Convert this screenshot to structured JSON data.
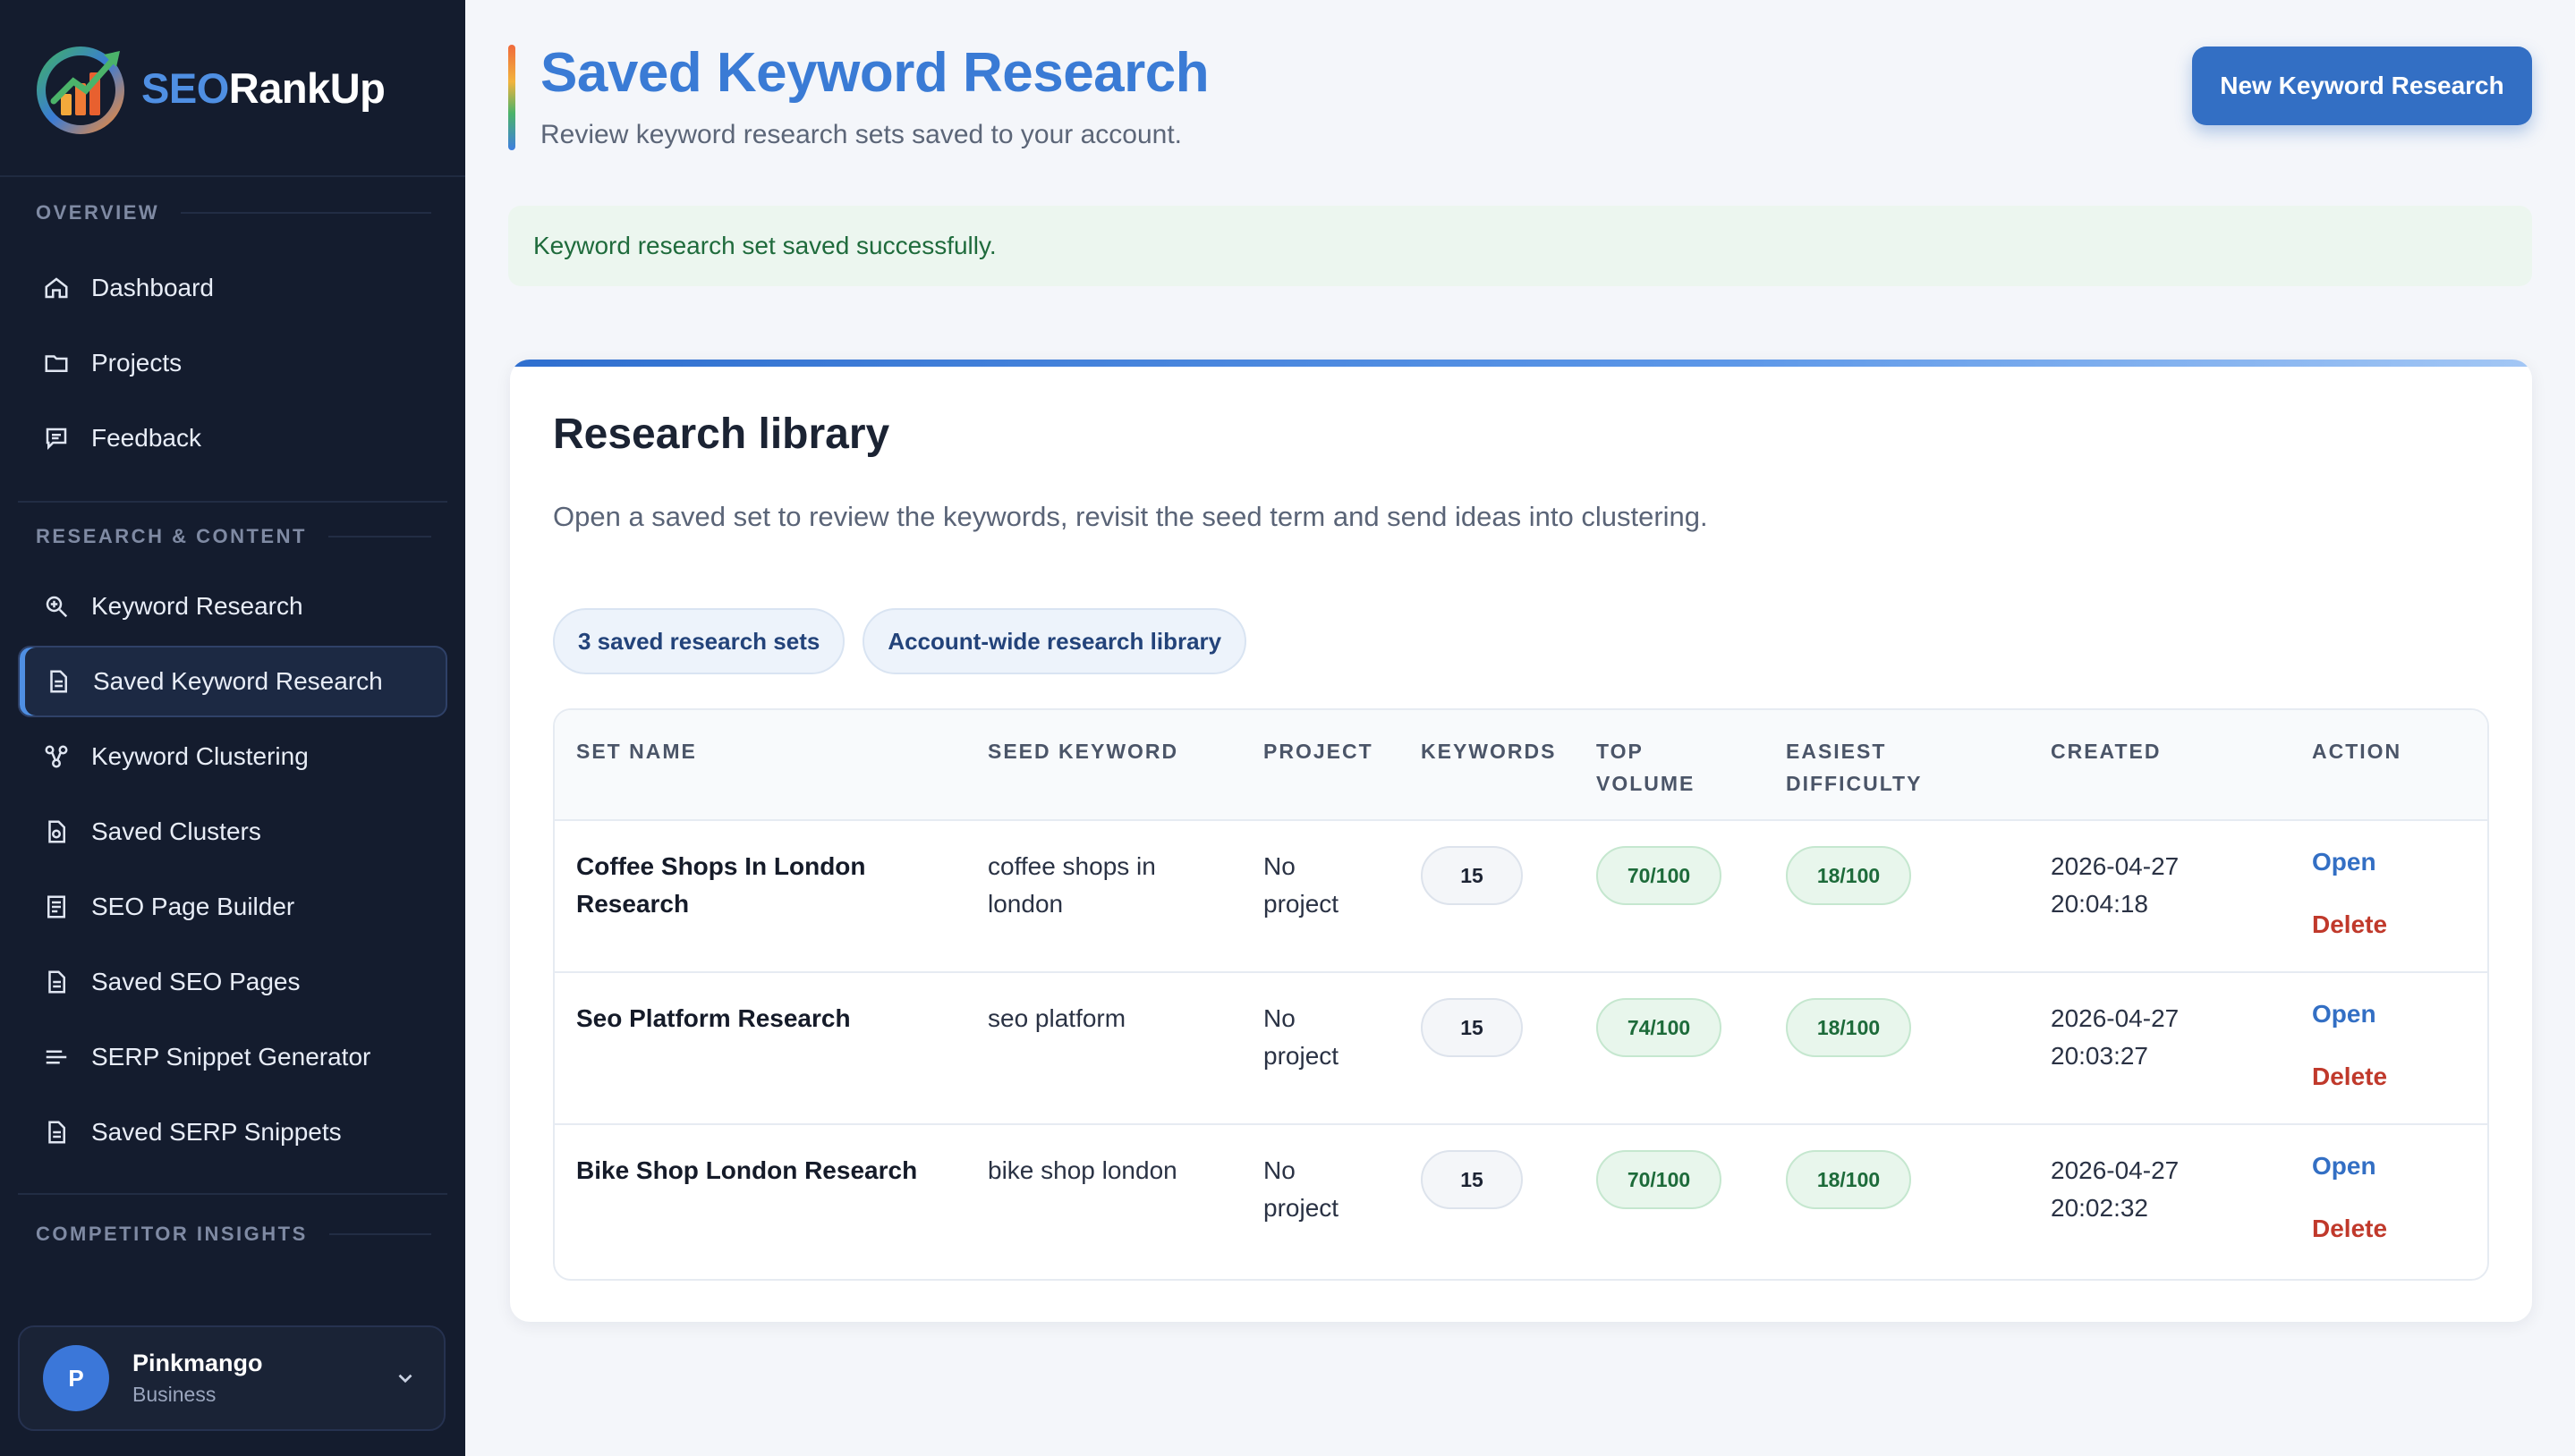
{
  "brand": {
    "name_part1": "SEO",
    "name_part2": "RankUp"
  },
  "sidebar": {
    "sections": [
      {
        "label": "OVERVIEW"
      },
      {
        "label": "RESEARCH & CONTENT"
      },
      {
        "label": "COMPETITOR INSIGHTS"
      }
    ],
    "items": [
      {
        "label": "Dashboard",
        "icon": "home-icon"
      },
      {
        "label": "Projects",
        "icon": "folder-icon"
      },
      {
        "label": "Feedback",
        "icon": "chat-icon"
      },
      {
        "label": "Keyword Research",
        "icon": "search-icon"
      },
      {
        "label": "Saved Keyword Research",
        "icon": "document-icon",
        "active": true
      },
      {
        "label": "Keyword Clustering",
        "icon": "cluster-icon"
      },
      {
        "label": "Saved Clusters",
        "icon": "saved-document-icon"
      },
      {
        "label": "SEO Page Builder",
        "icon": "page-icon"
      },
      {
        "label": "Saved SEO Pages",
        "icon": "document-icon"
      },
      {
        "label": "SERP Snippet Generator",
        "icon": "lines-icon"
      },
      {
        "label": "Saved SERP Snippets",
        "icon": "document-icon"
      }
    ],
    "user": {
      "initial": "P",
      "name": "Pinkmango",
      "plan": "Business"
    }
  },
  "header": {
    "title": "Saved Keyword Research",
    "subtitle": "Review keyword research sets saved to your account.",
    "new_button": "New Keyword Research"
  },
  "alert": {
    "text": "Keyword research set saved successfully."
  },
  "library": {
    "title": "Research library",
    "description": "Open a saved set to review the keywords, revisit the seed term and send ideas into clustering.",
    "pills": [
      "3 saved research sets",
      "Account-wide research library"
    ],
    "columns": {
      "set_name": "SET NAME",
      "seed_keyword": "SEED KEYWORD",
      "project": "PROJECT",
      "keywords": "KEYWORDS",
      "top_volume_1": "TOP",
      "top_volume_2": "VOLUME",
      "easiest_difficulty_1": "EASIEST",
      "easiest_difficulty_2": "DIFFICULTY",
      "created": "CREATED",
      "action": "ACTION"
    },
    "rows": [
      {
        "name_1": "Coffee Shops In London",
        "name_2": "Research",
        "seed_1": "coffee shops in",
        "seed_2": "london",
        "project_1": "No",
        "project_2": "project",
        "keywords": "15",
        "top_volume": "70/100",
        "difficulty": "18/100",
        "date": "2026-04-27",
        "time": "20:04:18",
        "open": "Open",
        "delete": "Delete"
      },
      {
        "name_1": "Seo Platform Research",
        "name_2": "",
        "seed_1": "seo platform",
        "seed_2": "",
        "project_1": "No",
        "project_2": "project",
        "keywords": "15",
        "top_volume": "74/100",
        "difficulty": "18/100",
        "date": "2026-04-27",
        "time": "20:03:27",
        "open": "Open",
        "delete": "Delete"
      },
      {
        "name_1": "Bike Shop London Research",
        "name_2": "",
        "seed_1": "bike shop london",
        "seed_2": "",
        "project_1": "No",
        "project_2": "project",
        "keywords": "15",
        "top_volume": "70/100",
        "difficulty": "18/100",
        "date": "2026-04-27",
        "time": "20:02:32",
        "open": "Open",
        "delete": "Delete"
      }
    ]
  },
  "colors": {
    "sidebar_bg": "#141c2e",
    "accent": "#336fc4",
    "title": "#3a7bd5",
    "success_bg": "#ecf6ef",
    "danger": "#c0392b"
  }
}
